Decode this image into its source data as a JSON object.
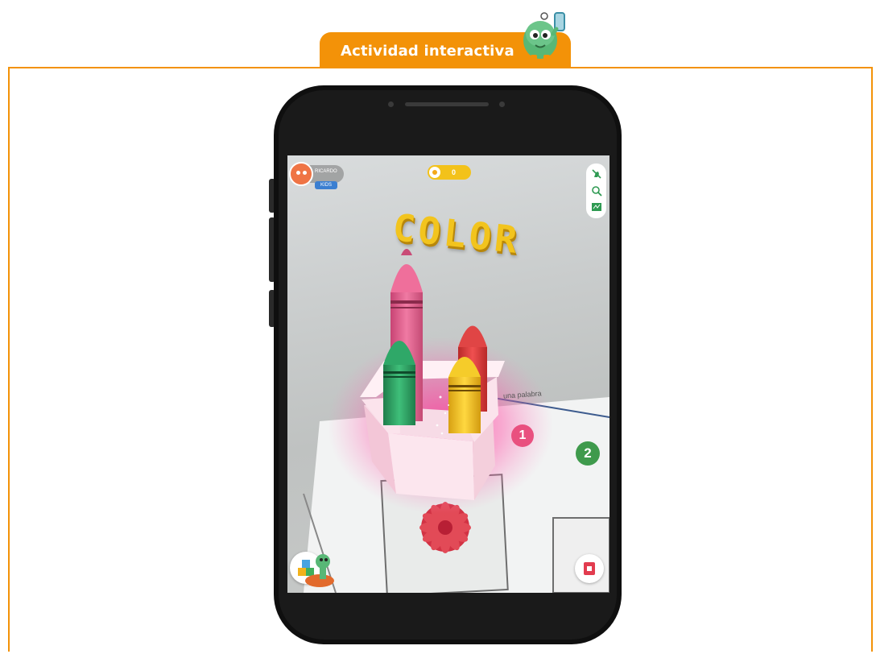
{
  "header": {
    "tab_label": "Actividad interactiva"
  },
  "app": {
    "profile_name": "RICARDO",
    "profile_badge": "KIDS",
    "coin_count": "0",
    "ar_word": "COLOR",
    "marker_1": "1",
    "marker_2": "2",
    "paper_text": "una palabra"
  },
  "colors": {
    "accent": "#f39208",
    "crayon_pink": "#e2628f",
    "crayon_green": "#27a061",
    "crayon_red": "#df3a3a",
    "crayon_yellow": "#f1c21b",
    "word_yellow": "#f2c41e"
  },
  "icons": [
    "mascot-icon",
    "avatar-icon",
    "coin-icon",
    "no-hand-icon",
    "search-icon",
    "map-icon",
    "blocks-icon",
    "card-icon",
    "flower-icon"
  ]
}
